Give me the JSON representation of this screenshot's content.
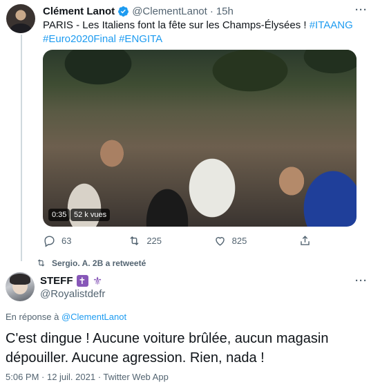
{
  "parent_tweet": {
    "author_name": "Clément Lanot",
    "author_handle": "@ClementLanot",
    "separator": "·",
    "time": "15h",
    "more_label": "···",
    "text_plain": "PARIS - Les Italiens font la fête sur les Champs-Élysées ! ",
    "hashtags": [
      "#ITAANG",
      "#Euro2020Final",
      "#ENGITA"
    ],
    "video": {
      "duration": "0:35",
      "views": "52 k vues"
    },
    "actions": {
      "replies": "63",
      "retweets": "225",
      "likes": "825"
    }
  },
  "retweet_context": {
    "text": "Sergio. A. 2B a retweeté"
  },
  "main_tweet": {
    "author_name": "STEFF",
    "emoji_1": "✝",
    "emoji_2": "⚜",
    "author_handle": "@Royalistdefr",
    "more_label": "···",
    "reply_prefix": "En réponse à ",
    "reply_to_handle": "@ClementLanot",
    "text": "C'est dingue ! Aucune voiture brûlée, aucun magasin dépouiller. Aucune agression. Rien, nada !",
    "timestamp": "5:06 PM · 12 juil. 2021 · Twitter Web App"
  },
  "colors": {
    "link": "#1d9bf0",
    "muted": "#536471",
    "text": "#0f1419",
    "verified": "#1d9bf0",
    "emoji_purple": "#8757b8"
  }
}
